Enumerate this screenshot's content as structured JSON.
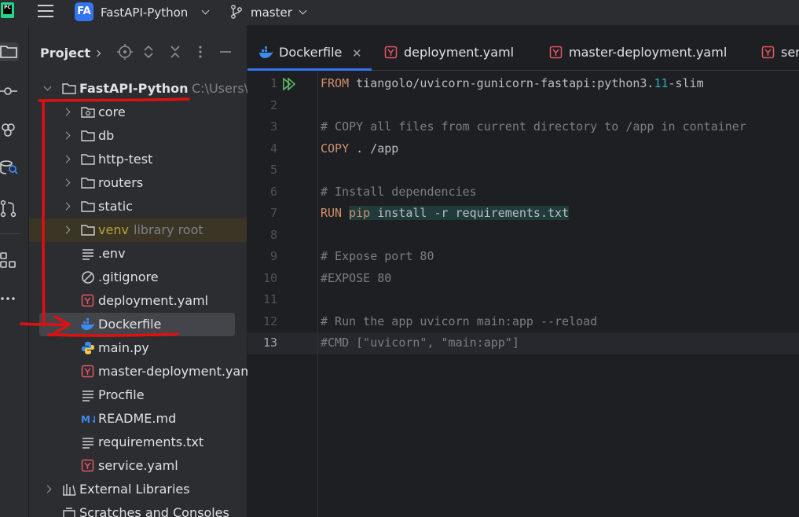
{
  "topbar": {
    "app_logo_text": "PC",
    "project_badge": "FA",
    "project_name": "FastAPI-Python",
    "branch": "master"
  },
  "project_panel": {
    "title": "Project",
    "root": {
      "name": "FastAPI-Python",
      "path": "C:\\Users\\"
    },
    "items": [
      {
        "label": "core",
        "kind": "folder-module"
      },
      {
        "label": "db",
        "kind": "folder"
      },
      {
        "label": "http-test",
        "kind": "folder"
      },
      {
        "label": "routers",
        "kind": "folder"
      },
      {
        "label": "static",
        "kind": "folder"
      },
      {
        "label": "venv",
        "kind": "folder",
        "hint": "library root"
      },
      {
        "label": ".env",
        "kind": "text-file"
      },
      {
        "label": ".gitignore",
        "kind": "ignore-file"
      },
      {
        "label": "deployment.yaml",
        "kind": "yaml-file"
      },
      {
        "label": "Dockerfile",
        "kind": "docker-file",
        "selected": true
      },
      {
        "label": "main.py",
        "kind": "python-file"
      },
      {
        "label": "master-deployment.yaml",
        "kind": "yaml-file"
      },
      {
        "label": "Procfile",
        "kind": "text-file"
      },
      {
        "label": "README.md",
        "kind": "markdown-file"
      },
      {
        "label": "requirements.txt",
        "kind": "text-file"
      },
      {
        "label": "service.yaml",
        "kind": "yaml-file"
      }
    ],
    "external_libraries": "External Libraries",
    "scratches": "Scratches and Consoles"
  },
  "tabs": [
    {
      "label": "Dockerfile",
      "icon": "docker-icon",
      "active": true
    },
    {
      "label": "deployment.yaml",
      "icon": "yaml-icon"
    },
    {
      "label": "master-deployment.yaml",
      "icon": "yaml-icon"
    },
    {
      "label": "ser",
      "icon": "yaml-icon"
    }
  ],
  "editor": {
    "current_line": 13,
    "lines": [
      {
        "n": "1",
        "parts": [
          [
            "kw",
            "FROM"
          ],
          [
            "",
            "tiangolo/uvicorn-gunicorn-fastapi:python3."
          ],
          [
            "num",
            "11"
          ],
          [
            "",
            "-slim"
          ]
        ]
      },
      {
        "n": "2",
        "parts": []
      },
      {
        "n": "3",
        "parts": [
          [
            "cm",
            "# COPY all files from current directory to /app in container"
          ]
        ]
      },
      {
        "n": "4",
        "parts": [
          [
            "kw",
            "COPY"
          ],
          [
            "",
            " . /app"
          ]
        ]
      },
      {
        "n": "5",
        "parts": []
      },
      {
        "n": "6",
        "parts": [
          [
            "cm",
            "# Install dependencies"
          ]
        ]
      },
      {
        "n": "7",
        "parts": [
          [
            "kw",
            "RUN "
          ],
          [
            "kwhl",
            "pip"
          ],
          [
            "hl",
            " install -r requirements.txt"
          ]
        ]
      },
      {
        "n": "8",
        "parts": []
      },
      {
        "n": "9",
        "parts": [
          [
            "cm",
            "# Expose port 80"
          ]
        ]
      },
      {
        "n": "10",
        "parts": [
          [
            "cm",
            "#EXPOSE 80"
          ]
        ]
      },
      {
        "n": "11",
        "parts": []
      },
      {
        "n": "12",
        "parts": [
          [
            "cm",
            "# Run the app uvicorn main:app --reload"
          ]
        ]
      },
      {
        "n": "13",
        "parts": [
          [
            "cm",
            "#CMD [\"uvicorn\", \"main:app\"]"
          ]
        ]
      }
    ]
  },
  "colors": {
    "accent": "#3574f0",
    "annotation": "#e01010",
    "yaml_icon": "#e55765",
    "docker_icon": "#3d8bef"
  }
}
